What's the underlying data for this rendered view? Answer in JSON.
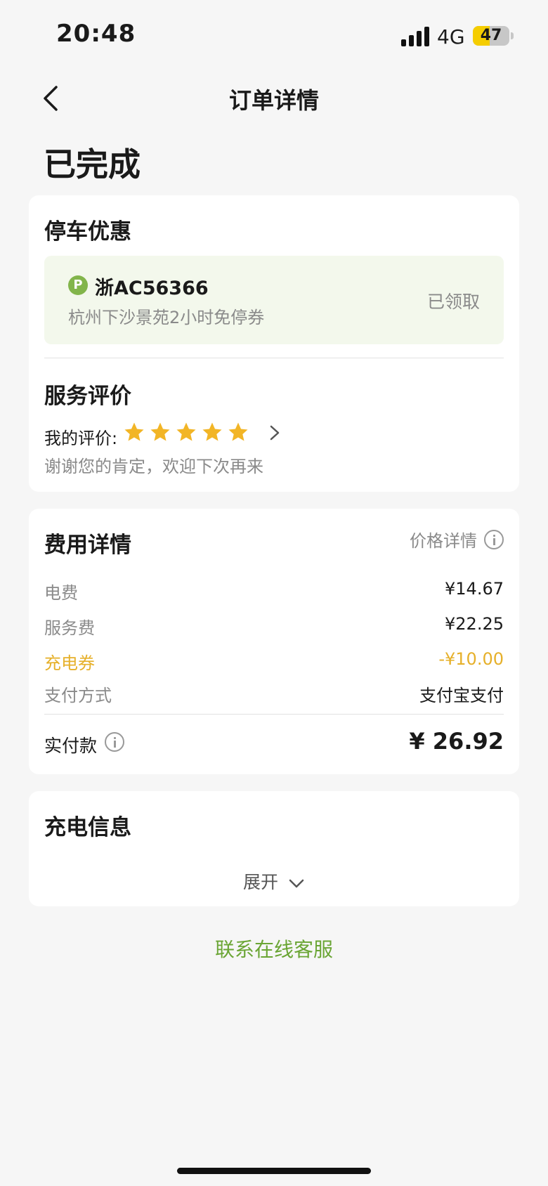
{
  "status_bar": {
    "time": "20:48",
    "network": "4G",
    "battery_level": "47",
    "battery_fraction": 0.47
  },
  "nav": {
    "title": "订单详情"
  },
  "order_status": "已完成",
  "parking": {
    "title": "停车优惠",
    "badge": "P",
    "plate": "浙AC56366",
    "description": "杭州下沙景苑2小时免停券",
    "status": "已领取"
  },
  "review": {
    "title": "服务评价",
    "label": "我的评价:",
    "stars": 5,
    "star_color": "#f2b526",
    "comment": "谢谢您的肯定，欢迎下次再来"
  },
  "fees": {
    "title": "费用详情",
    "price_detail_link": "价格详情",
    "rows": [
      {
        "label": "电费",
        "value": "¥14.67"
      },
      {
        "label": "服务费",
        "value": "¥22.25"
      },
      {
        "label": "充电券",
        "value": "-¥10.00"
      },
      {
        "label": "支付方式",
        "value": "支付宝支付"
      }
    ],
    "paid_label": "实付款",
    "paid_amount": "¥ 26.92",
    "coupon_color": "#e6b02a"
  },
  "charging": {
    "title": "充电信息",
    "expand_label": "展开"
  },
  "contact_label": "联系在线客服",
  "accent_color": "#6aa534"
}
